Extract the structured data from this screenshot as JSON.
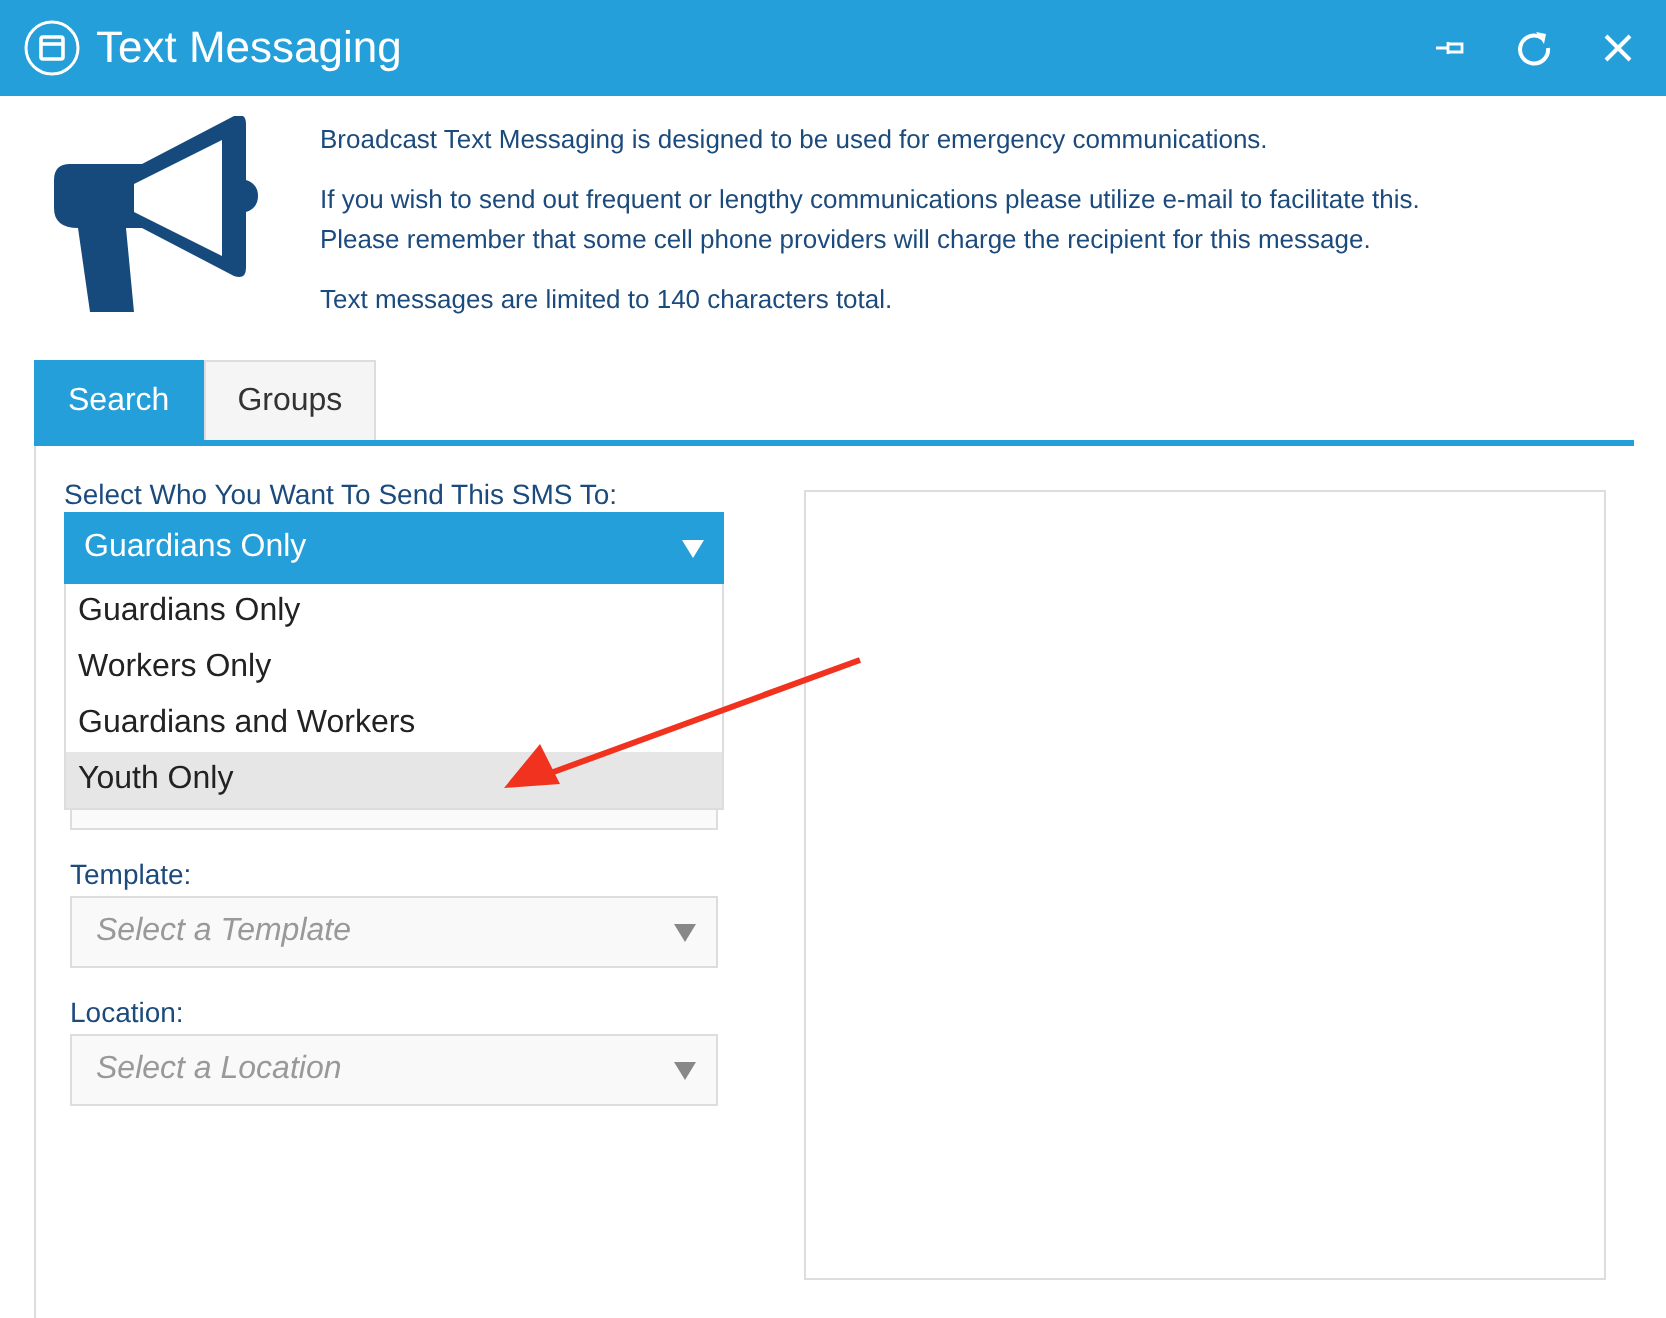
{
  "window": {
    "title": "Text Messaging"
  },
  "info": [
    "Broadcast Text Messaging is designed to be used for emergency communications.",
    "If you wish to send out frequent or lengthy communications please utilize e-mail to facilitate this.\nPlease remember that some cell phone providers will charge the recipient for this message.",
    "Text messages are limited to 140 characters total."
  ],
  "tabs": [
    {
      "label": "Search",
      "selected": true
    },
    {
      "label": "Groups",
      "selected": false
    }
  ],
  "recipient": {
    "label": "Select Who You Want To Send This SMS To:",
    "value": "Guardians Only",
    "expanded": true,
    "options": [
      {
        "label": "Guardians Only",
        "highlighted": false
      },
      {
        "label": "Workers Only",
        "highlighted": false
      },
      {
        "label": "Guardians and Workers",
        "highlighted": false
      },
      {
        "label": "Youth Only",
        "highlighted": true
      }
    ]
  },
  "fields": [
    {
      "label": "Template:",
      "placeholder": "Select a Template"
    },
    {
      "label": "Location:",
      "placeholder": "Select a Location"
    }
  ]
}
